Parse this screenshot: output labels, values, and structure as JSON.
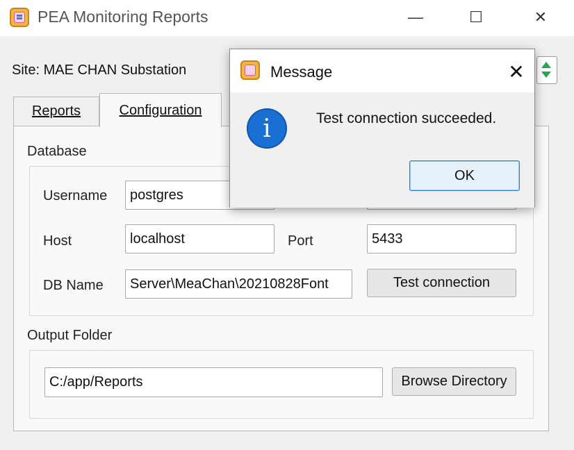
{
  "window": {
    "title": "PEA Monitoring Reports",
    "minimize_glyph": "—",
    "maximize_glyph": "☐",
    "close_glyph": "✕"
  },
  "site": {
    "label": "Site:  MAE CHAN Substation"
  },
  "tabs": [
    {
      "label": "Reports",
      "active": false
    },
    {
      "label": "Configuration",
      "active": true
    }
  ],
  "database": {
    "title": "Database",
    "username_label": "Username",
    "username_value": "postgres",
    "host_label": "Host",
    "host_value": "localhost",
    "port_label": "Port",
    "port_value": "5433",
    "dbname_label": "DB Name",
    "dbname_value": "Server\\MeaChan\\20210828Font",
    "test_button": "Test connection"
  },
  "output": {
    "title": "Output Folder",
    "path_value": "C:/app/Reports",
    "browse_button": "Browse Directory"
  },
  "dialog": {
    "title": "Message",
    "close_glyph": "✕",
    "info_glyph": "i",
    "message": "Test connection succeeded.",
    "ok_button": "OK"
  },
  "colors": {
    "info_blue": "#1a6fd2",
    "spinner_green": "#2aa652",
    "ok_border": "#2a7fd4"
  }
}
